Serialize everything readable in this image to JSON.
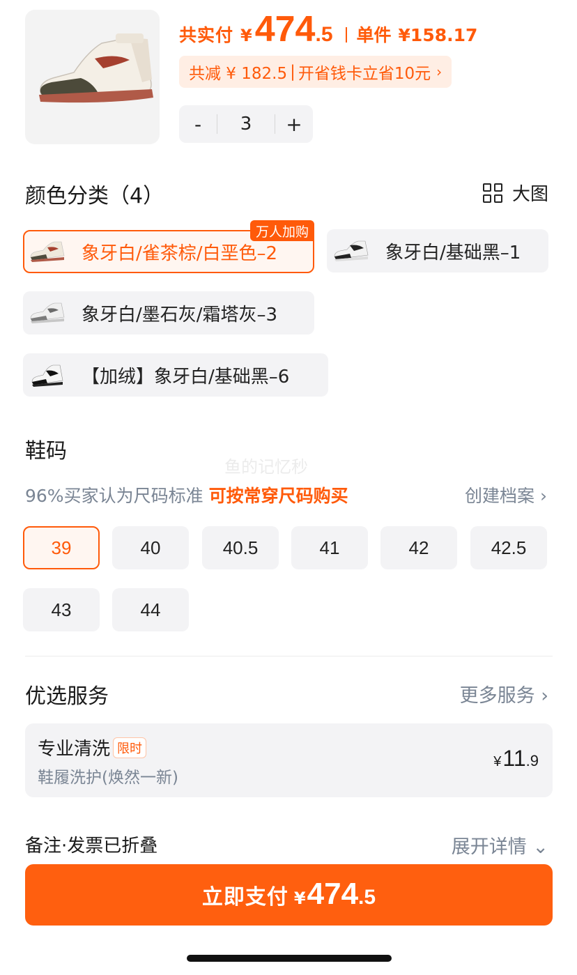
{
  "summary": {
    "total_label": "共实付",
    "currency": "¥",
    "total_int": "474",
    "total_dec": ".5",
    "unit_label": "单件",
    "unit_price": "¥158.17",
    "discount_text": "共减 ¥ 182.5",
    "discount_pipe": "|",
    "discount_extra": "开省钱卡立省10元",
    "chevron": "›",
    "quantity": "3",
    "minus": "-",
    "plus": "+"
  },
  "color_section": {
    "title": "颜色分类（4）",
    "big_view_label": "大图",
    "options": [
      {
        "label": "象牙白/雀茶棕/白垩色–2",
        "badge": "万人加购",
        "selected": true
      },
      {
        "label": "象牙白/基础黑–1",
        "selected": false
      },
      {
        "label": "象牙白/墨石灰/霜塔灰–3",
        "selected": false
      },
      {
        "label": "【加绒】象牙白/基础黑–6",
        "selected": false
      }
    ]
  },
  "size_section": {
    "title": "鞋码",
    "hint": "96%买家认为尺码标准",
    "hint_highlight": "可按常穿尺码购买",
    "profile_link": "创建档案 ›",
    "sizes": [
      "39",
      "40",
      "40.5",
      "41",
      "42",
      "42.5",
      "43",
      "44"
    ],
    "selected_index": 0
  },
  "service_section": {
    "title": "优选服务",
    "more": "更多服务 ›",
    "item": {
      "name": "专业清洗",
      "tag": "限时",
      "desc": "鞋履洗护(焕然一新)",
      "currency": "¥",
      "price_int": "11",
      "price_dec": ".9"
    }
  },
  "footer": {
    "remark": "备注·发票已折叠",
    "expand": "展开详情 ⌄",
    "pay_label": "立即支付",
    "pay_currency": "¥",
    "pay_int": "474",
    "pay_dec": ".5"
  },
  "watermark": "鱼的记忆秒",
  "colors": {
    "accent": "#ff5a0a",
    "chip_bg": "#f3f3f5",
    "muted": "#7a8594"
  },
  "icons": [
    "sneaker-thumbnail",
    "grid-view-icon",
    "chevron-right-icon",
    "chevron-down-icon"
  ]
}
